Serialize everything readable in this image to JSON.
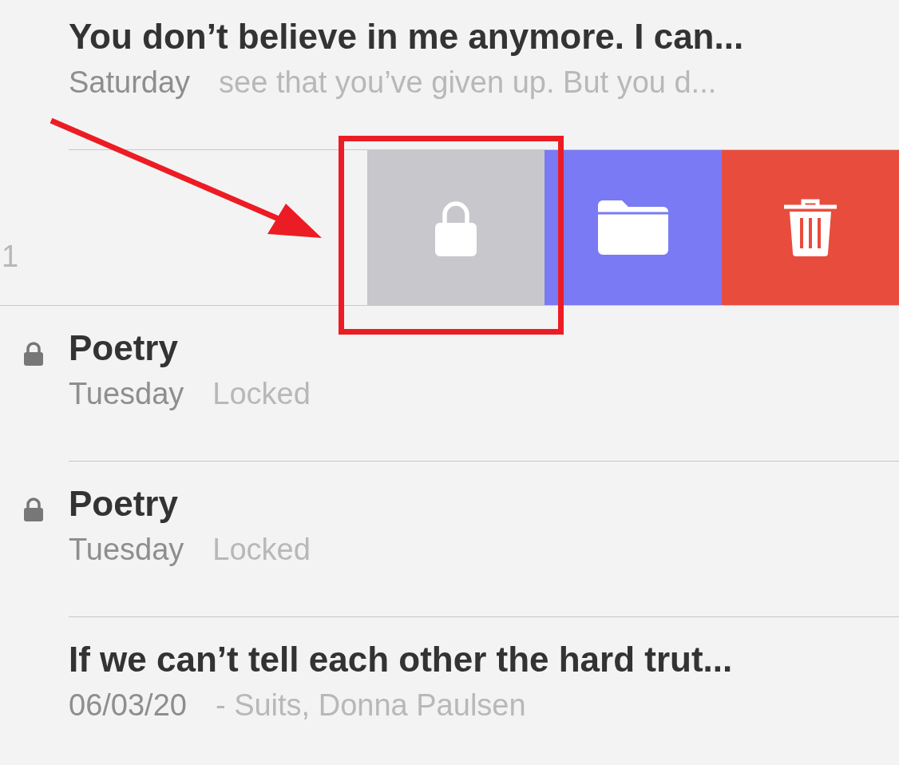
{
  "notes": [
    {
      "kind": "note",
      "title": "You don’t believe in me anymore. I can...",
      "date": "Saturday",
      "preview": "see that you’ve given up. But you d...",
      "locked": false
    },
    {
      "kind": "swiped",
      "fragment": "1",
      "actions": [
        {
          "kind": "lock",
          "highlighted": true
        },
        {
          "kind": "folder",
          "highlighted": false
        },
        {
          "kind": "delete",
          "highlighted": false
        }
      ]
    },
    {
      "kind": "note",
      "title": "Poetry",
      "date": "Tuesday",
      "preview": "Locked",
      "locked": true
    },
    {
      "kind": "note",
      "title": "Poetry",
      "date": "Tuesday",
      "preview": "Locked",
      "locked": true
    },
    {
      "kind": "note",
      "title": "If we can’t tell each other the hard trut...",
      "date": "06/03/20",
      "preview": "- Suits, Donna Paulsen",
      "locked": false
    }
  ]
}
